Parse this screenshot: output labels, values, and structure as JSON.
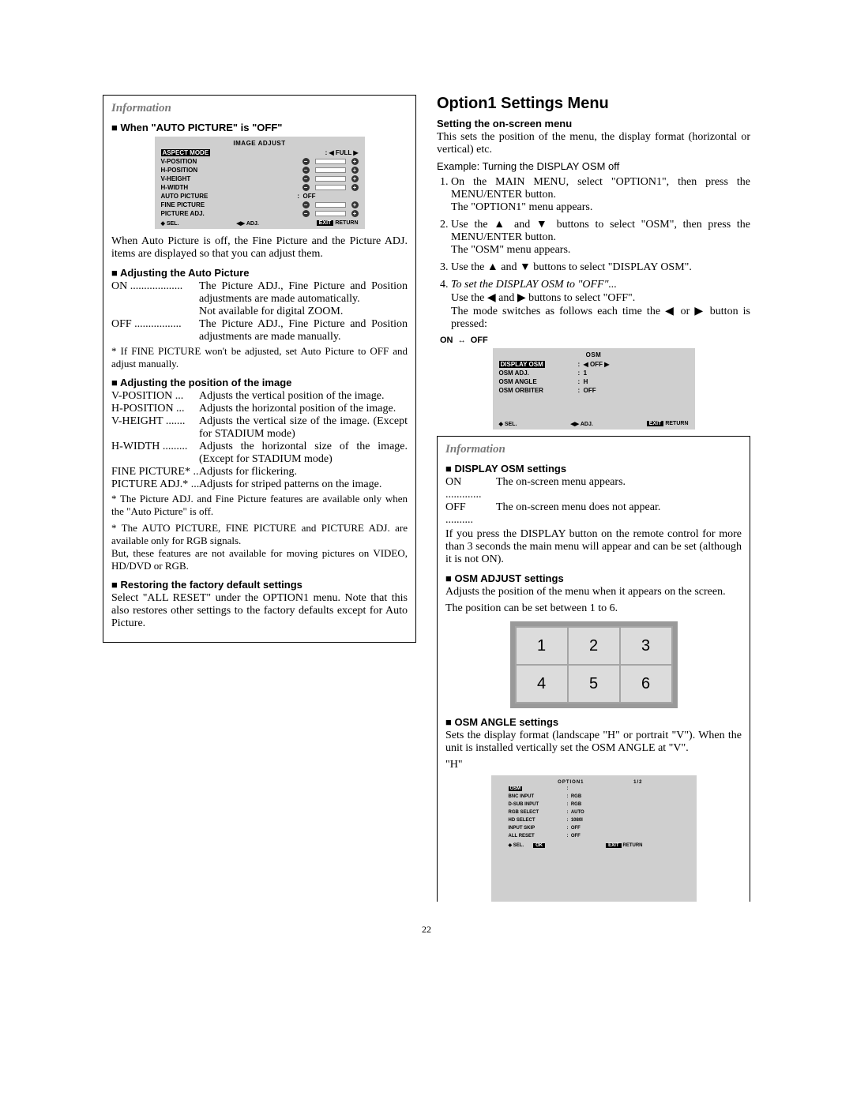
{
  "page_number": "22",
  "left": {
    "info_heading": "Information",
    "h1": "When \"AUTO PICTURE\" is \"OFF\"",
    "osd1": {
      "title": "IMAGE ADJUST",
      "rows": [
        {
          "label": "ASPECT MODE",
          "type": "sel",
          "value": "FULL"
        },
        {
          "label": "V-POSITION",
          "type": "bar"
        },
        {
          "label": "H-POSITION",
          "type": "bar"
        },
        {
          "label": "V-HEIGHT",
          "type": "bar"
        },
        {
          "label": "H-WIDTH",
          "type": "bar"
        },
        {
          "label": "AUTO PICTURE",
          "type": "plain",
          "value": "OFF"
        },
        {
          "label": "FINE PICTURE",
          "type": "bar"
        },
        {
          "label": "PICTURE ADJ.",
          "type": "bar"
        }
      ],
      "foot_sel": "SEL.",
      "foot_adj": "ADJ.",
      "foot_exit": "EXIT",
      "foot_return": "RETURN"
    },
    "p1": "When Auto Picture is off, the Fine Picture and the Picture ADJ. items are displayed so that you can adjust them.",
    "h2": "Adjusting the Auto Picture",
    "auto_on_t": "ON ...................",
    "auto_on_d": "The Picture ADJ., Fine Picture and Position adjustments are made automatically.\nNot available for digital ZOOM.",
    "auto_off_t": "OFF .................",
    "auto_off_d": "The Picture ADJ., Fine Picture and Position adjustments are made manually.",
    "note1": "* If FINE PICTURE won't be adjusted, set Auto Picture to OFF and adjust manually.",
    "h3": "Adjusting the position of the image",
    "rows": [
      {
        "t": "V-POSITION ...",
        "d": "Adjusts the vertical position of the image."
      },
      {
        "t": "H-POSITION ...",
        "d": "Adjusts the horizontal position of the image."
      },
      {
        "t": "V-HEIGHT .......",
        "d": "Adjusts the vertical size of the image. (Except for STADIUM mode)"
      },
      {
        "t": "H-WIDTH .........",
        "d": "Adjusts the horizontal size of the image. (Except for STADIUM mode)"
      },
      {
        "t": "FINE PICTURE* ..",
        "d": "Adjusts for flickering."
      },
      {
        "t": "PICTURE ADJ.* ...",
        "d": "Adjusts for striped patterns on the image."
      }
    ],
    "note2": "* The Picture ADJ. and Fine Picture features are available only when the \"Auto Picture\" is off.",
    "note3": "* The AUTO PICTURE, FINE PICTURE and PICTURE ADJ. are available only for RGB signals.\nBut, these features are not available for moving pictures on VIDEO, HD/DVD or RGB.",
    "h4": "Restoring the factory default settings",
    "p_restore": "Select \"ALL RESET\" under the OPTION1 menu. Note that this also restores other settings to the factory defaults except for Auto Picture."
  },
  "right": {
    "title": "Option1 Settings Menu",
    "sub": "Setting the on-screen menu",
    "intro": "This sets the position of the menu, the display format (horizontal or vertical) etc.",
    "example": "Example: Turning the DISPLAY OSM off",
    "steps": [
      "On the MAIN MENU, select \"OPTION1\", then press the MENU/ENTER button.\nThe \"OPTION1\" menu appears.",
      "Use the ▲ and ▼ buttons to select \"OSM\", then press the MENU/ENTER button.\nThe \"OSM\" menu appears.",
      "Use the ▲ and ▼ buttons to select \"DISPLAY OSM\"."
    ],
    "step4_i": "To set the DISPLAY OSM to \"OFF\"...",
    "step4_a": "Use the ◀ and ▶ buttons to select \"OFF\".",
    "step4_b": "The mode switches as follows each time the ◀ or ▶ button is pressed:",
    "onoff": "ON  ↔  OFF",
    "osd2": {
      "title": "OSM",
      "rows": [
        {
          "l": "DISPLAY OSM",
          "v": "◀ OFF ▶",
          "sel": true
        },
        {
          "l": "OSM ADJ.",
          "v": "1"
        },
        {
          "l": "OSM ANGLE",
          "v": "H"
        },
        {
          "l": "OSM ORBITER",
          "v": "OFF"
        }
      ],
      "foot_sel": "SEL.",
      "foot_adj": "ADJ.",
      "foot_exit": "EXIT",
      "foot_return": "RETURN"
    },
    "info_heading": "Information",
    "h_disp": "DISPLAY OSM settings",
    "disp_on_t": "ON .............",
    "disp_on_d": "The on-screen menu appears.",
    "disp_off_t": "OFF ..........",
    "disp_off_d": "The on-screen menu does not appear.",
    "disp_p": "If you press the DISPLAY button on the remote control for more than 3 seconds the main menu will appear and can be set (although it is not ON).",
    "h_adj": "OSM ADJUST settings",
    "adj_p1": "Adjusts the position of the menu when it appears on the screen.",
    "adj_p2": "The position can be set between 1 to 6.",
    "grid": [
      "1",
      "2",
      "3",
      "4",
      "5",
      "6"
    ],
    "h_angle": "OSM ANGLE settings",
    "angle_p": "Sets the display format (landscape \"H\" or portrait \"V\"). When the unit is installed vertically set the OSM ANGLE at \"V\".",
    "angle_h": "\"H\"",
    "osd3": {
      "title": "OPTION1",
      "page": "1/2",
      "rows": [
        {
          "l": "OSM",
          "v": "",
          "sel": true
        },
        {
          "l": "BNC INPUT",
          "v": "RGB"
        },
        {
          "l": "D-SUB INPUT",
          "v": "RGB"
        },
        {
          "l": "RGB SELECT",
          "v": "AUTO"
        },
        {
          "l": "HD SELECT",
          "v": "1080I"
        },
        {
          "l": "INPUT SKIP",
          "v": "OFF"
        },
        {
          "l": "ALL RESET",
          "v": "OFF"
        }
      ],
      "foot_sel": "SEL.",
      "foot_ok": "OK",
      "foot_exit": "EXIT",
      "foot_return": "RETURN"
    }
  }
}
